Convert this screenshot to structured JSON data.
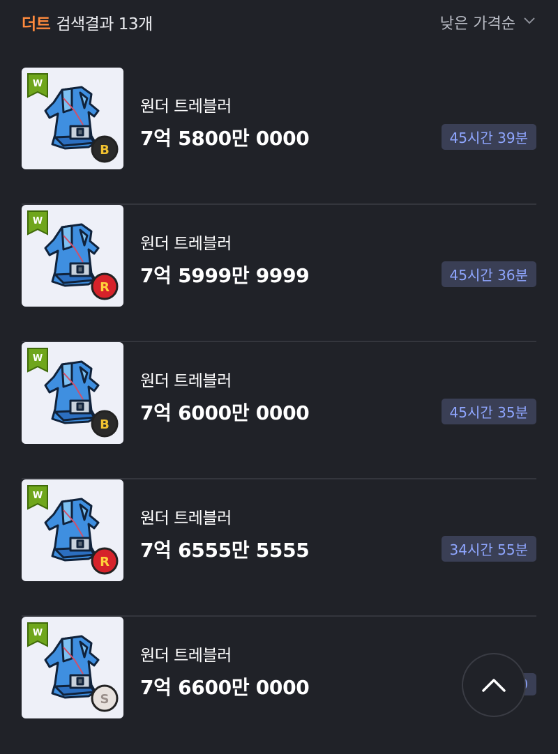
{
  "header": {
    "keyword": "더트",
    "result_text": "검색결과 13개",
    "sort_label": "낮은 가격순"
  },
  "colors": {
    "background": "#202228",
    "keyword": "#ff8a3d",
    "time_badge_text": "#8fa6ff",
    "time_badge_bg": "#3a3f55"
  },
  "items": [
    {
      "name": "원더 트레블러",
      "price": "7억 5800만 0000",
      "time_left": "45시간 39분",
      "badge": "B",
      "item_icon": "wonder-traveler-overall-icon"
    },
    {
      "name": "원더 트레블러",
      "price": "7억 5999만 9999",
      "time_left": "45시간 36분",
      "badge": "R",
      "item_icon": "wonder-traveler-overall-icon"
    },
    {
      "name": "원더 트레블러",
      "price": "7억 6000만 0000",
      "time_left": "45시간 35분",
      "badge": "B",
      "item_icon": "wonder-traveler-overall-icon"
    },
    {
      "name": "원더 트레블러",
      "price": "7억 6555만 5555",
      "time_left": "34시간 55분",
      "badge": "R",
      "item_icon": "wonder-traveler-overall-icon"
    },
    {
      "name": "원더 트레블러",
      "price": "7억 6600만 0000",
      "time_left": "40",
      "badge": "S",
      "item_icon": "wonder-traveler-overall-icon"
    }
  ],
  "wonder_tag_letter": "W",
  "scroll_top_icon": "chevron-up-icon"
}
